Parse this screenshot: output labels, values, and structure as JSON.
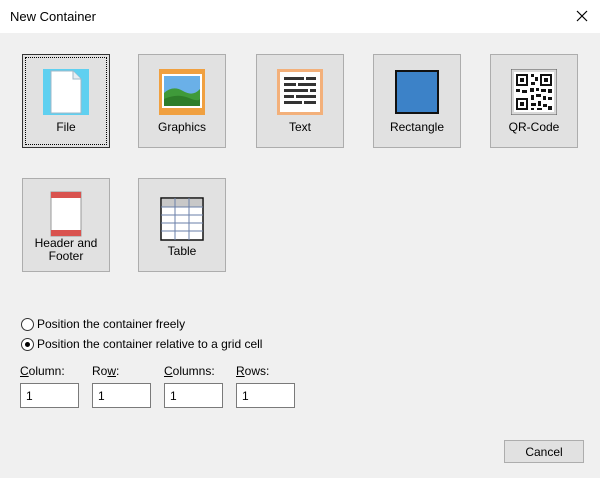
{
  "window": {
    "title": "New Container"
  },
  "tiles": [
    {
      "label": "File",
      "icon": "file-icon"
    },
    {
      "label": "Graphics",
      "icon": "graphics-icon"
    },
    {
      "label": "Text",
      "icon": "text-icon"
    },
    {
      "label": "Rectangle",
      "icon": "rectangle-icon"
    },
    {
      "label": "QR-Code",
      "icon": "qr-code-icon"
    },
    {
      "label_line1": "Header and",
      "label_line2": "Footer",
      "icon": "header-footer-icon"
    },
    {
      "label": "Table",
      "icon": "table-icon"
    }
  ],
  "positioning": {
    "option_free": "Position the container freely",
    "option_grid": "Position the container relative to a grid cell",
    "selected": "grid"
  },
  "fields": {
    "column": {
      "label_prefix": "",
      "label_mnemonic": "C",
      "label_rest": "olumn:",
      "value": "1"
    },
    "row": {
      "label_prefix": "Ro",
      "label_mnemonic": "w",
      "label_rest": ":",
      "value": "1"
    },
    "columns": {
      "label_prefix": "",
      "label_mnemonic": "C",
      "label_rest": "olumns:",
      "value": "1"
    },
    "rows": {
      "label_prefix": "",
      "label_mnemonic": "R",
      "label_rest": "ows:",
      "value": "1"
    }
  },
  "buttons": {
    "cancel": "Cancel"
  },
  "colors": {
    "file_accent": "#5fd0f0",
    "rectangle_fill": "#3c82c8",
    "header_band": "#d9534f"
  }
}
